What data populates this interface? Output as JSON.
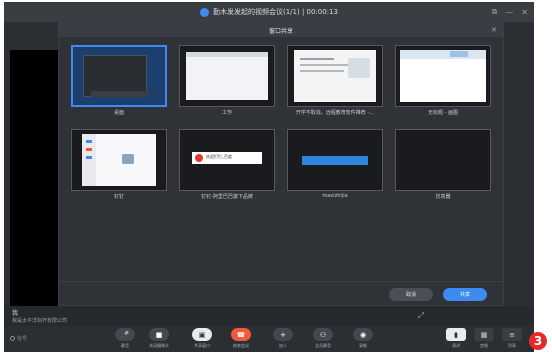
{
  "window": {
    "title": "勤木发发起的视频会议(1/1) | 00:00:13",
    "controls": [
      "⧉",
      "—",
      "✕"
    ]
  },
  "dialog": {
    "title": "窗口共享",
    "close_icon": "✕",
    "tiles": [
      {
        "label": "桌面",
        "selected": true
      },
      {
        "label": "工作",
        "selected": false
      },
      {
        "label": "开学不取消，远程教育软件推荐 -…",
        "selected": false
      },
      {
        "label": "无标题 - 画图",
        "selected": false
      },
      {
        "label": "钉钉",
        "selected": false
      },
      {
        "label": "钉钉-阿里巴巴旗下品牌",
        "selected": false
      },
      {
        "label": "maxizhijia",
        "selected": false
      },
      {
        "label": "仿真器",
        "selected": false
      }
    ],
    "cancel_label": "取消",
    "share_label": "共享",
    "mini_caption": "欢迎钉钉_百度"
  },
  "status": {
    "me": "我",
    "company": "我是太平洋标杆有限公司",
    "expand_icon": "⤢"
  },
  "toolbar": {
    "signal_label": "信号",
    "buttons": [
      {
        "label": "静音",
        "icon": "mic-icon",
        "glyph": "🎤"
      },
      {
        "label": "关闭摄像头",
        "icon": "camera-icon",
        "glyph": "■"
      },
      {
        "label": "共享窗口",
        "icon": "share-window-icon",
        "glyph": "▣"
      },
      {
        "label": "结束会议",
        "icon": "hangup-icon",
        "glyph": "☎"
      },
      {
        "label": "加人",
        "icon": "add-person-icon",
        "glyph": "+"
      },
      {
        "label": "全员静音",
        "icon": "mute-all-icon",
        "glyph": "⚇"
      },
      {
        "label": "录制",
        "icon": "record-icon",
        "glyph": "◉"
      }
    ],
    "views": [
      {
        "label": "演讲",
        "icon": "speaker-view-icon",
        "glyph": "▮"
      },
      {
        "label": "宫格",
        "icon": "grid-view-icon",
        "glyph": "▦"
      },
      {
        "label": "列表",
        "icon": "list-view-icon",
        "glyph": "≡"
      }
    ]
  },
  "annotation": {
    "number": "3"
  },
  "colors": {
    "background": "#2b2e33",
    "accent": "#3d8bf0",
    "danger": "#f05a3b",
    "badge": "#e62a2a"
  }
}
